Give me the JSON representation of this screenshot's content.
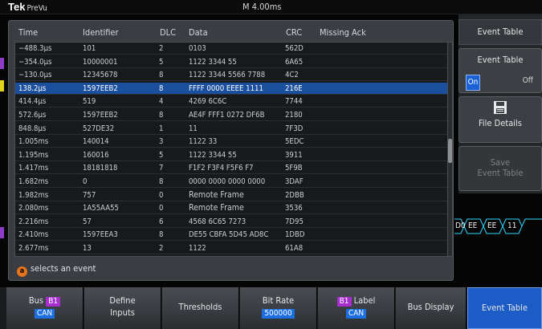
{
  "top": {
    "brand": "Tek",
    "product": "PreVu",
    "mode": "M 4.00ms"
  },
  "table": {
    "headers": [
      "Time",
      "Identifier",
      "DLC",
      "Data",
      "CRC",
      "Missing Ack"
    ],
    "rows": [
      {
        "time": "−488.3µs",
        "id": "101",
        "dlc": "2",
        "data": "0103",
        "crc": "562D"
      },
      {
        "time": "−354.0µs",
        "id": "10000001",
        "dlc": "5",
        "data": "1122 3344 55",
        "crc": "6A65"
      },
      {
        "time": "−130.0µs",
        "id": "12345678",
        "dlc": "8",
        "data": "1122 3344 5566 7788",
        "crc": "4C2"
      },
      {
        "time": "138.2µs",
        "id": "1597EEB2",
        "dlc": "8",
        "data": "FFFF 0000 EEEE 1111",
        "crc": "216E",
        "selected": true
      },
      {
        "time": "414.4µs",
        "id": "519",
        "dlc": "4",
        "data": "4269 6C6C",
        "crc": "7744"
      },
      {
        "time": "572.6µs",
        "id": "1597EEB2",
        "dlc": "8",
        "data": "AE4F FFF1 0272 DF6B",
        "crc": "2180"
      },
      {
        "time": "848.8µs",
        "id": "527DE32",
        "dlc": "1",
        "data": "11",
        "crc": "7F3D"
      },
      {
        "time": "1.005ms",
        "id": "140014",
        "dlc": "3",
        "data": "1122 33",
        "crc": "5EDC"
      },
      {
        "time": "1.195ms",
        "id": "160016",
        "dlc": "5",
        "data": "1122 3344 55",
        "crc": "3911"
      },
      {
        "time": "1.417ms",
        "id": "18181818",
        "dlc": "7",
        "data": "F1F2 F3F4 F5F6 F7",
        "crc": "5F9B"
      },
      {
        "time": "1.682ms",
        "id": "0",
        "dlc": "8",
        "data": "0000 0000 0000 0000",
        "crc": "3DAF"
      },
      {
        "time": "1.982ms",
        "id": "757",
        "dlc": "0",
        "data": "Remote Frame",
        "crc": "2DBB",
        "remote": true
      },
      {
        "time": "2.080ms",
        "id": "1A55AA55",
        "dlc": "0",
        "data": "Remote Frame",
        "crc": "3536",
        "remote": true
      },
      {
        "time": "2.216ms",
        "id": "57",
        "dlc": "6",
        "data": "4568 6C65 7273",
        "crc": "7D95"
      },
      {
        "time": "2.410ms",
        "id": "1597EEA3",
        "dlc": "8",
        "data": "DE55 CBFA 5D45 AD8C",
        "crc": "1DBD"
      },
      {
        "time": "2.677ms",
        "id": "13",
        "dlc": "2",
        "data": "1122",
        "crc": "61A8"
      }
    ]
  },
  "hint": {
    "badge": "a",
    "text": "selects an event"
  },
  "right_menu": {
    "title": "Event Table",
    "toggle_label": "Event Table",
    "on": "On",
    "off": "Off",
    "file_details": "File Details",
    "save_line1": "Save",
    "save_line2": "Event Table"
  },
  "wave": [
    "D0",
    "EE",
    "EE",
    "11"
  ],
  "bottom": {
    "bus_label": "Bus",
    "bus_tag": "B1",
    "bus_value": "CAN",
    "define1": "Define",
    "define2": "Inputs",
    "thresholds": "Thresholds",
    "bitrate_label": "Bit Rate",
    "bitrate_value": "500000",
    "label_tag": "B1",
    "label_text": "Label",
    "label_value": "CAN",
    "bus_display": "Bus Display",
    "event_table": "Event Table"
  }
}
